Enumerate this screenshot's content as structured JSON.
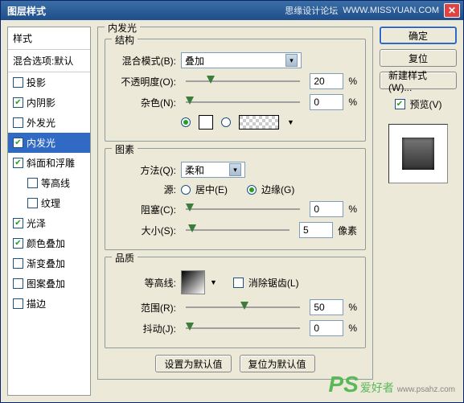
{
  "title": "图层样式",
  "site": {
    "name": "思缘设计论坛",
    "url": "WWW.MISSYUAN.COM"
  },
  "styles": {
    "header": "样式",
    "blend_default": "混合选项:默认",
    "items": [
      {
        "label": "投影",
        "checked": false,
        "indent": false
      },
      {
        "label": "内阴影",
        "checked": true,
        "indent": false
      },
      {
        "label": "外发光",
        "checked": false,
        "indent": false
      },
      {
        "label": "内发光",
        "checked": true,
        "indent": false,
        "selected": true
      },
      {
        "label": "斜面和浮雕",
        "checked": true,
        "indent": false
      },
      {
        "label": "等高线",
        "checked": false,
        "indent": true
      },
      {
        "label": "纹理",
        "checked": false,
        "indent": true
      },
      {
        "label": "光泽",
        "checked": true,
        "indent": false
      },
      {
        "label": "颜色叠加",
        "checked": true,
        "indent": false
      },
      {
        "label": "渐变叠加",
        "checked": false,
        "indent": false
      },
      {
        "label": "图案叠加",
        "checked": false,
        "indent": false
      },
      {
        "label": "描边",
        "checked": false,
        "indent": false
      }
    ]
  },
  "section_title": "内发光",
  "structure": {
    "title": "结构",
    "blend_mode_label": "混合模式(B):",
    "blend_mode_value": "叠加",
    "opacity_label": "不透明度(O):",
    "opacity_value": "20",
    "opacity_unit": "%",
    "noise_label": "杂色(N):",
    "noise_value": "0",
    "noise_unit": "%"
  },
  "elements": {
    "title": "图素",
    "method_label": "方法(Q):",
    "method_value": "柔和",
    "source_label": "源:",
    "center_label": "居中(E)",
    "edge_label": "边缘(G)",
    "choke_label": "阻塞(C):",
    "choke_value": "0",
    "choke_unit": "%",
    "size_label": "大小(S):",
    "size_value": "5",
    "size_unit": "像素"
  },
  "quality": {
    "title": "品质",
    "contour_label": "等高线:",
    "antialias_label": "消除锯齿(L)",
    "range_label": "范围(R):",
    "range_value": "50",
    "range_unit": "%",
    "jitter_label": "抖动(J):",
    "jitter_value": "0",
    "jitter_unit": "%"
  },
  "bottom": {
    "set_default": "设置为默认值",
    "reset_default": "复位为默认值"
  },
  "right": {
    "ok": "确定",
    "cancel": "复位",
    "new_style": "新建样式(W)...",
    "preview_label": "预览(V)"
  },
  "watermark": {
    "logo": "PS",
    "txt": "爱好者",
    "sub": "www.psahz.com"
  }
}
